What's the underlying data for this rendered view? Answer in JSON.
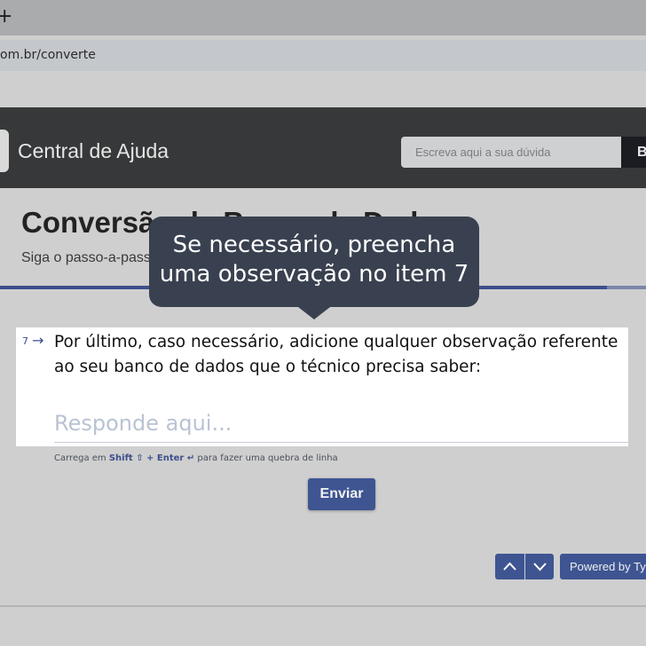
{
  "browser": {
    "new_tab_symbol": "+",
    "url": "om.br/converte"
  },
  "header": {
    "brand": "Central de Ajuda",
    "search_placeholder": "Escreva aqui a sua dúvida",
    "search_button_label": "B"
  },
  "page": {
    "title": "Conversão de Banco de Dados",
    "subtitle": "Siga o passo-a-passo",
    "progress": 0.94
  },
  "tooltip": {
    "text": "Se necessário, preencha uma observação no item 7"
  },
  "question": {
    "number": "7",
    "text": "Por último, caso necessário, adicione qualquer observação referente ao seu banco de dados que o técnico precisa saber:",
    "answer_placeholder": "Responde aqui..."
  },
  "hint": {
    "prefix": "Carrega em ",
    "shift": "Shift ⇧",
    "plus": " + ",
    "enter": "Enter ↵",
    "suffix": " para fazer uma quebra de linha"
  },
  "actions": {
    "submit_label": "Enviar",
    "powered_by": "Powered by Typ"
  },
  "colors": {
    "header_bg": "#373839",
    "accent": "#3e5592",
    "tooltip_bg": "#394150"
  }
}
